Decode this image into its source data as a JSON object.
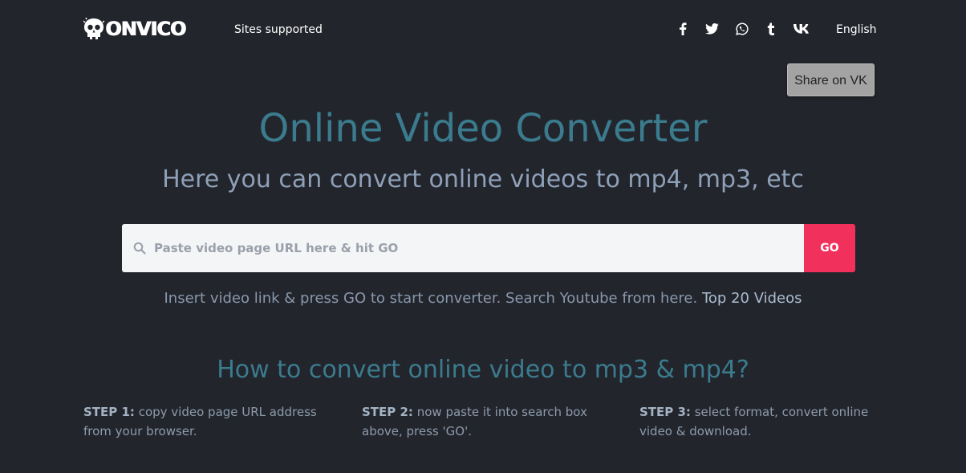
{
  "header": {
    "logo_text": "ONVICO",
    "nav": {
      "sites_supported": "Sites supported"
    },
    "social_icons": [
      {
        "name": "facebook-icon"
      },
      {
        "name": "twitter-icon"
      },
      {
        "name": "whatsapp-icon"
      },
      {
        "name": "tumblr-icon"
      },
      {
        "name": "vk-icon"
      }
    ],
    "language": "English"
  },
  "share_vk_button": "Share on VK",
  "hero": {
    "title": "Online Video Converter",
    "subtitle": "Here you can convert online videos to mp4, mp3, etc"
  },
  "search": {
    "placeholder": "Paste video page URL here & hit GO",
    "value": "",
    "go_label": "GO",
    "hint_text": "Insert video link & press GO to start converter. Search Youtube from here.",
    "hint_link": "Top 20 Videos"
  },
  "howto": {
    "title": "How to convert online video to mp3 & mp4?",
    "steps": [
      {
        "label": "STEP 1:",
        "text": "copy video page URL address from your browser."
      },
      {
        "label": "STEP 2:",
        "text": "now paste it into search box above, press 'GO'."
      },
      {
        "label": "STEP 3:",
        "text": "select format, convert online video & download."
      }
    ]
  },
  "colors": {
    "background": "#23252c",
    "accent_title": "#3b7b8e",
    "go_button": "#f1315c",
    "share_button": "#a3a3a3"
  }
}
